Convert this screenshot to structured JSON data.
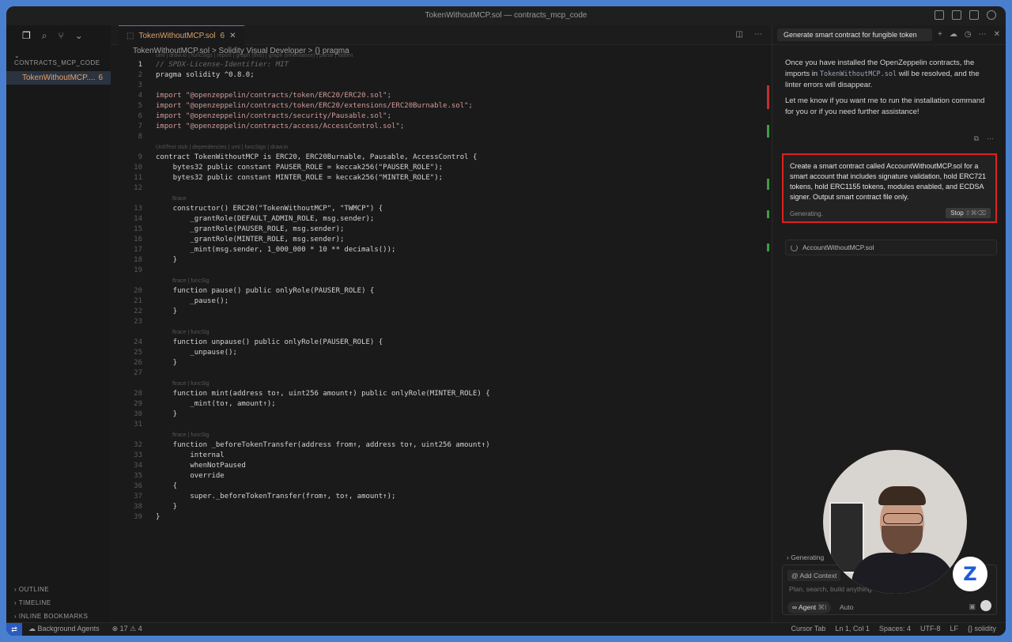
{
  "window": {
    "title": "TokenWithoutMCP.sol — contracts_mcp_code"
  },
  "explorer": {
    "title": "CONTRACTS_MCP_CODE",
    "file_name": "TokenWithoutMCP....",
    "file_problems": "6",
    "bottom_sections": [
      "OUTLINE",
      "TIMELINE",
      "INLINE BOOKMARKS"
    ]
  },
  "editor": {
    "tab_label": "TokenWithoutMCP.sol",
    "tab_problems": "6",
    "breadcrumb": "TokenWithoutMCP.sol  >  Solidity Visual Developer  >  {} pragma",
    "lens_top": "uml | draw.io | funcSigs | report | graph (this) | graph (inheritance) | parse | flatten",
    "lens_contract": "UnitTest stub | dependencies | uml | funcSigs | draw.io",
    "lens_ftrace": "ftrace",
    "lens_ftrace_funcsig": "ftrace | funcSig",
    "lines": [
      {
        "n": "1",
        "t": "// SPDX-License-Identifier: MIT"
      },
      {
        "n": "2",
        "t": "pragma solidity ^0.8.0;"
      },
      {
        "n": "3",
        "t": ""
      },
      {
        "n": "4",
        "t": "import \"@openzeppelin/contracts/token/ERC20/ERC20.sol\";"
      },
      {
        "n": "5",
        "t": "import \"@openzeppelin/contracts/token/ERC20/extensions/ERC20Burnable.sol\";"
      },
      {
        "n": "6",
        "t": "import \"@openzeppelin/contracts/security/Pausable.sol\";"
      },
      {
        "n": "7",
        "t": "import \"@openzeppelin/contracts/access/AccessControl.sol\";"
      },
      {
        "n": "8",
        "t": ""
      },
      {
        "n": "9",
        "t": "contract TokenWithoutMCP is ERC20, ERC20Burnable, Pausable, AccessControl {"
      },
      {
        "n": "10",
        "t": "    bytes32 public constant PAUSER_ROLE = keccak256(\"PAUSER_ROLE\");"
      },
      {
        "n": "11",
        "t": "    bytes32 public constant MINTER_ROLE = keccak256(\"MINTER_ROLE\");"
      },
      {
        "n": "12",
        "t": ""
      },
      {
        "n": "13",
        "t": "    constructor() ERC20(\"TokenWithoutMCP\", \"TWMCP\") {"
      },
      {
        "n": "14",
        "t": "        _grantRole(DEFAULT_ADMIN_ROLE, msg.sender);"
      },
      {
        "n": "15",
        "t": "        _grantRole(PAUSER_ROLE, msg.sender);"
      },
      {
        "n": "16",
        "t": "        _grantRole(MINTER_ROLE, msg.sender);"
      },
      {
        "n": "17",
        "t": "        _mint(msg.sender, 1_000_000 * 10 ** decimals());"
      },
      {
        "n": "18",
        "t": "    }"
      },
      {
        "n": "19",
        "t": ""
      },
      {
        "n": "20",
        "t": "    function pause() public onlyRole(PAUSER_ROLE) {"
      },
      {
        "n": "21",
        "t": "        _pause();"
      },
      {
        "n": "22",
        "t": "    }"
      },
      {
        "n": "23",
        "t": ""
      },
      {
        "n": "24",
        "t": "    function unpause() public onlyRole(PAUSER_ROLE) {"
      },
      {
        "n": "25",
        "t": "        _unpause();"
      },
      {
        "n": "26",
        "t": "    }"
      },
      {
        "n": "27",
        "t": ""
      },
      {
        "n": "28",
        "t": "    function mint(address to↑, uint256 amount↑) public onlyRole(MINTER_ROLE) {"
      },
      {
        "n": "29",
        "t": "        _mint(to↑, amount↑);"
      },
      {
        "n": "30",
        "t": "    }"
      },
      {
        "n": "31",
        "t": ""
      },
      {
        "n": "32",
        "t": "    function _beforeTokenTransfer(address from↑, address to↑, uint256 amount↑)"
      },
      {
        "n": "33",
        "t": "        internal"
      },
      {
        "n": "34",
        "t": "        whenNotPaused"
      },
      {
        "n": "35",
        "t": "        override"
      },
      {
        "n": "36",
        "t": "    {"
      },
      {
        "n": "37",
        "t": "        super._beforeTokenTransfer(from↑, to↑, amount↑);"
      },
      {
        "n": "38",
        "t": "    }"
      },
      {
        "n": "39",
        "t": "}"
      }
    ]
  },
  "chat": {
    "tab_title": "Generate smart contract for fungible token",
    "message_1_pre": "Once you have installed the OpenZeppelin contracts, the imports in ",
    "message_1_code": "TokenWithoutMCP.sol",
    "message_1_post": " will be resolved, and the linter errors will disappear.",
    "message_2": "Let me know if you want me to run the installation command for you or if you need further assistance!",
    "prompt": "Create a smart contract called AccountWithoutMCP.sol for a smart account that includes signature validation, hold ERC721 tokens, hold ERC1155 tokens, modules enabled, and ECDSA signer. Output smart contract file only.",
    "status": "Generating.",
    "stop_label": "Stop",
    "stop_shortcut": "⇧⌘⌫",
    "file_chip": "AccountWithoutMCP.sol",
    "generating_label": "Generating",
    "add_context": "Add Context",
    "input_placeholder": "Plan, search, build anything",
    "agent_label": "Agent",
    "agent_shortcut": "⌘I",
    "auto_label": "Auto"
  },
  "statusbar": {
    "agents": "Background Agents",
    "errors": "17",
    "warnings": "4",
    "cursor_tab": "Cursor Tab",
    "position": "Ln 1, Col 1",
    "spaces": "Spaces: 4",
    "encoding": "UTF-8",
    "eol": "LF",
    "language": "solidity"
  },
  "logo": {
    "letter": "Z",
    "color": "#1e5bd8"
  },
  "colors": {
    "accent": "#4b7bd8",
    "highlight_border": "#e02020",
    "error": "#c03030",
    "added": "#3aa040"
  }
}
